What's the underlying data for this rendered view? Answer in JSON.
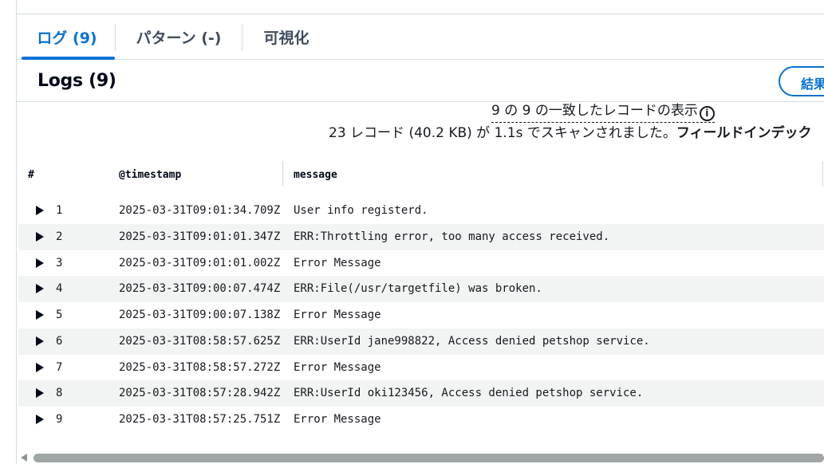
{
  "tabs": [
    {
      "label": "ログ (9)",
      "active": true
    },
    {
      "label": "パターン (-)",
      "active": false
    },
    {
      "label": "可視化",
      "active": false
    }
  ],
  "logs_header": {
    "title": "Logs (9)",
    "results_button_label": "結果"
  },
  "summary": {
    "match_text": "9 の 9 の一致したレコードの表示",
    "info_icon": "info-icon",
    "scan_text": "23 レコード (40.2 KB) が 1.1s でスキャンされました。",
    "scan_link_text": "フィールドインデック"
  },
  "table": {
    "columns": [
      "#",
      "@timestamp",
      "message"
    ],
    "rows": [
      {
        "num": "1",
        "timestamp": "2025-03-31T09:01:34.709Z",
        "message": "User info registerd."
      },
      {
        "num": "2",
        "timestamp": "2025-03-31T09:01:01.347Z",
        "message": "ERR:Throttling error, too many access received."
      },
      {
        "num": "3",
        "timestamp": "2025-03-31T09:01:01.002Z",
        "message": "Error Message"
      },
      {
        "num": "4",
        "timestamp": "2025-03-31T09:00:07.474Z",
        "message": "ERR:File(/usr/targetfile) was broken."
      },
      {
        "num": "5",
        "timestamp": "2025-03-31T09:00:07.138Z",
        "message": "Error Message"
      },
      {
        "num": "6",
        "timestamp": "2025-03-31T08:58:57.625Z",
        "message": "ERR:UserId jane998822, Access denied petshop service."
      },
      {
        "num": "7",
        "timestamp": "2025-03-31T08:58:57.272Z",
        "message": "Error Message"
      },
      {
        "num": "8",
        "timestamp": "2025-03-31T08:57:28.942Z",
        "message": "ERR:UserId oki123456, Access denied petshop service."
      },
      {
        "num": "9",
        "timestamp": "2025-03-31T08:57:25.751Z",
        "message": "Error Message"
      }
    ]
  },
  "colors": {
    "accent": "#0972d3",
    "text": "#16191f",
    "row_alt": "#f2f3f3",
    "border": "#d5dbdb"
  }
}
